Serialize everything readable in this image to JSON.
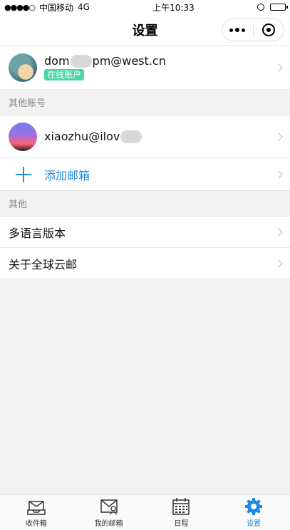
{
  "status_bar": {
    "signal": "●●●●○",
    "carrier": "中国移动",
    "network": "4G",
    "time": "上午10:33"
  },
  "nav": {
    "title": "设置"
  },
  "main_account": {
    "email_prefix": "dom",
    "email_suffix": "pm@west.cn",
    "badge": "在线账户"
  },
  "other_accounts": {
    "header": "其他账号",
    "items": [
      {
        "email_prefix": "xiaozhu@ilov"
      }
    ],
    "add_label": "添加邮箱"
  },
  "other": {
    "header": "其他",
    "items": [
      {
        "label": "多语言版本"
      },
      {
        "label": "关于全球云邮"
      }
    ]
  },
  "tab_bar": {
    "tabs": [
      {
        "label": "收件箱",
        "icon": "inbox-icon"
      },
      {
        "label": "我的邮箱",
        "icon": "my-mailbox-icon"
      },
      {
        "label": "日程",
        "icon": "calendar-icon"
      },
      {
        "label": "设置",
        "icon": "gear-icon"
      }
    ],
    "active_color": "#1e88e5"
  },
  "colors": {
    "accent": "#1e88e5",
    "badge": "#4cd6a5"
  }
}
